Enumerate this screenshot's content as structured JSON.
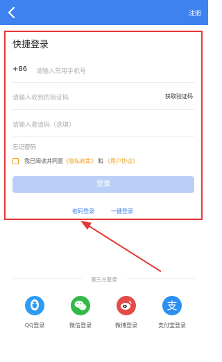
{
  "header": {
    "register_label": "注册",
    "accent": "#3e82f0"
  },
  "form": {
    "title": "快捷登录",
    "country_code": "+86",
    "phone_placeholder": "请输入常用手机号",
    "code_placeholder": "请输入收到的验证码",
    "get_code_label": "获取验证码",
    "invite_placeholder": "请输入邀请码（选填）",
    "forgot_label": "忘记密码",
    "agree_prefix": "我已阅读并同意",
    "privacy_label": "《隐私政策》",
    "and_label": "和",
    "terms_label": "《用户协议》",
    "login_label": "登录",
    "password_login_label": "密码登录",
    "one_key_login_label": "一键登录"
  },
  "third_party": {
    "title": "第三方登录",
    "items": [
      {
        "label": "QQ登录",
        "icon": "qq-icon",
        "color": "#2f9bf0"
      },
      {
        "label": "微信登录",
        "icon": "wechat-icon",
        "color": "#35b84a"
      },
      {
        "label": "微博登录",
        "icon": "weibo-icon",
        "color": "#e24b47"
      },
      {
        "label": "支付宝登录",
        "icon": "alipay-icon",
        "color": "#2a8ff0"
      }
    ]
  },
  "annotation_color": "#e53935"
}
